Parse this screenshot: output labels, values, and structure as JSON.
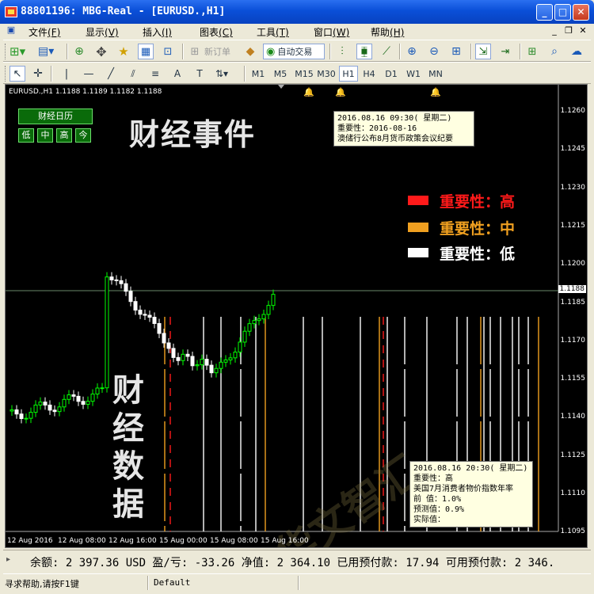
{
  "window": {
    "title": "88801196: MBG-Real - [EURUSD.,H1]"
  },
  "menu": [
    {
      "label": "文件",
      "key": "(F)"
    },
    {
      "label": "显示",
      "key": "(V)"
    },
    {
      "label": "插入",
      "key": "(I)"
    },
    {
      "label": "图表",
      "key": "(C)"
    },
    {
      "label": "工具",
      "key": "(T)"
    },
    {
      "label": "窗口",
      "key": "(W)"
    },
    {
      "label": "帮助",
      "key": "(H)"
    }
  ],
  "toolbar": {
    "new_order": "新订单",
    "auto_trade": "自动交易"
  },
  "timeframes": [
    "M1",
    "M5",
    "M15",
    "M30",
    "H1",
    "H4",
    "D1",
    "W1",
    "MN"
  ],
  "active_timeframe": "H1",
  "chart": {
    "symbol_label": "EURUSD.,H1  1.1188 1.1189 1.1182 1.1188",
    "calendar_button": "财经日历",
    "filter_buttons": [
      "低",
      "中",
      "高",
      "今"
    ],
    "headline": "财经事件",
    "vertical_title": [
      "财",
      "经",
      "数",
      "据"
    ],
    "watermark": "华文智汇",
    "popup_top": [
      "2016.08.16 09:30( 星期二)",
      "重要性：2016-08-16",
      "澳储行公布8月货币政策会议纪要"
    ],
    "popup_bottom": [
      "2016.08.16 20:30( 星期二)",
      "重要性：高",
      "美国7月消费者物价指数年率",
      "前    值：1.0%",
      "预测值：0.9%",
      "实际值："
    ],
    "legend": [
      {
        "label": "重要性：高",
        "color": "#ff1a1a"
      },
      {
        "label": "重要性：中",
        "color": "#f0a020"
      },
      {
        "label": "重要性：低",
        "color": "#ffffff"
      }
    ],
    "price_ticks": [
      "1.1260",
      "1.1245",
      "1.1230",
      "1.1215",
      "1.1200",
      "1.1185",
      "1.1170",
      "1.1155",
      "1.1140",
      "1.1125",
      "1.1110",
      "1.1095"
    ],
    "current_price": "1.1188",
    "time_ticks": [
      "12 Aug 2016",
      "12 Aug 08:00",
      "12 Aug 16:00",
      "15 Aug 00:00",
      "15 Aug 08:00",
      "15 Aug 16:00"
    ]
  },
  "account_bar": {
    "text": "余额: 2 397.36 USD  盈/亏: -33.26  净值: 2 364.10  已用预付款: 17.94  可用预付款: 2 346."
  },
  "status": {
    "help": "寻求帮助,请按F1键",
    "profile": "Default"
  },
  "colors": {
    "bull": "#00ff00",
    "bear": "#ffffff",
    "high": "#ff1a1a",
    "mid": "#f0a020",
    "low": "#ffffff"
  }
}
